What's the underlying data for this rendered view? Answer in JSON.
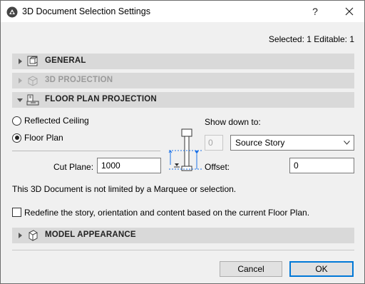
{
  "window": {
    "title": "3D Document Selection Settings",
    "help": "?"
  },
  "selection_info": "Selected: 1 Editable: 1",
  "panels": {
    "general": {
      "label": "GENERAL",
      "expanded": false,
      "enabled": true
    },
    "projection": {
      "label": "3D PROJECTION",
      "expanded": false,
      "enabled": false
    },
    "floor_plan": {
      "label": "FLOOR PLAN PROJECTION",
      "expanded": true,
      "enabled": true
    },
    "model": {
      "label": "MODEL APPEARANCE",
      "expanded": false,
      "enabled": true
    }
  },
  "floor_plan": {
    "options": [
      {
        "label": "Reflected Ceiling",
        "checked": false
      },
      {
        "label": "Floor Plan",
        "checked": true
      }
    ],
    "cut_plane": {
      "label": "Cut Plane:",
      "value": "1000"
    },
    "show_down_to": {
      "label": "Show down to:",
      "number_value": "0",
      "selected": "Source Story"
    },
    "offset": {
      "label": "Offset:",
      "value": "0"
    }
  },
  "marquee_note": "This 3D Document is not limited by a Marquee or selection.",
  "redefine": {
    "label": "Redefine the story, orientation and content based on the current Floor Plan.",
    "checked": false
  },
  "buttons": {
    "cancel": "Cancel",
    "ok": "OK"
  },
  "colors": {
    "accent": "#0078d7",
    "diagram_blue": "#1e73e8",
    "panel_bg": "#d9d9d9"
  }
}
